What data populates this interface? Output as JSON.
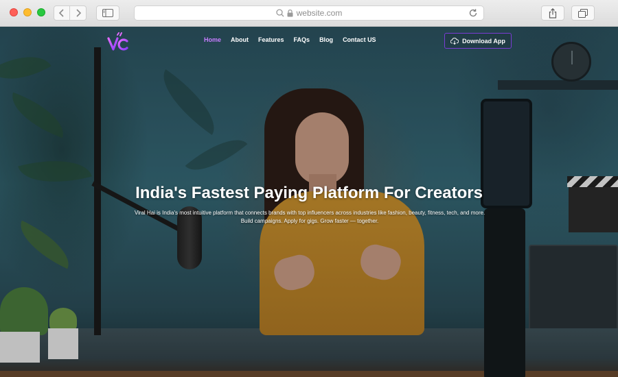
{
  "browser": {
    "url": "website.com",
    "icons": {
      "back": "chevron-left-icon",
      "forward": "chevron-right-icon",
      "sidebar": "sidebar-icon",
      "search": "search-icon",
      "lock": "lock-icon",
      "reload": "reload-icon",
      "share": "share-icon",
      "tabs": "tabs-icon"
    }
  },
  "site": {
    "logo_text": "VC",
    "nav": {
      "items": [
        "Home",
        "About",
        "Features",
        "FAQs",
        "Blog",
        "Contact US"
      ],
      "active": "Home"
    },
    "download_button": "Download App",
    "hero": {
      "title": "India's Fastest Paying Platform For Creators",
      "subtitle": "Viral Hai is India's most intuitive platform that connects brands with top influencers across industries like fashion, beauty, fitness, tech, and more. Build campaigns. Apply for gigs. Grow faster — together."
    },
    "colors": {
      "accent": "#c77dff",
      "button_border": "#7b3cd6"
    }
  }
}
